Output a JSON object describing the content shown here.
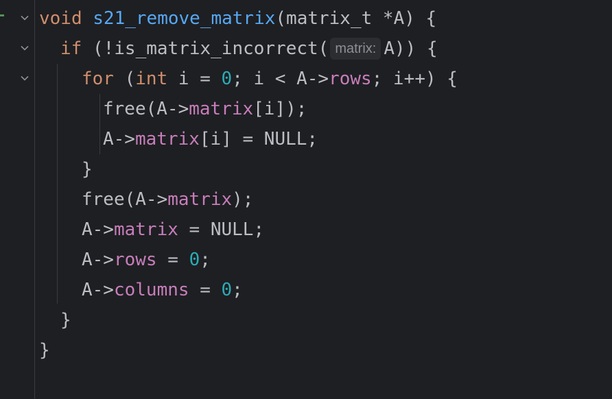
{
  "editor": {
    "lines": [
      {
        "tokens": [
          {
            "t": "kw",
            "v": "void"
          },
          {
            "t": "plain",
            "v": " "
          },
          {
            "t": "fn",
            "v": "s21_remove_matrix"
          },
          {
            "t": "plain",
            "v": "(matrix_t *A) {"
          }
        ]
      },
      {
        "tokens": [
          {
            "t": "kw",
            "v": "if"
          },
          {
            "t": "plain",
            "v": " (!is_matrix_incorrect("
          },
          {
            "t": "hint",
            "v": "matrix:"
          },
          {
            "t": "plain",
            "v": "A)) {"
          }
        ]
      },
      {
        "tokens": [
          {
            "t": "kw",
            "v": "for"
          },
          {
            "t": "plain",
            "v": " ("
          },
          {
            "t": "kw",
            "v": "int"
          },
          {
            "t": "plain",
            "v": " i = "
          },
          {
            "t": "num",
            "v": "0"
          },
          {
            "t": "plain",
            "v": "; i < A->"
          },
          {
            "t": "field",
            "v": "rows"
          },
          {
            "t": "plain",
            "v": "; i++) {"
          }
        ]
      },
      {
        "tokens": [
          {
            "t": "plain",
            "v": "free(A->"
          },
          {
            "t": "field",
            "v": "matrix"
          },
          {
            "t": "plain",
            "v": "[i]);"
          }
        ]
      },
      {
        "tokens": [
          {
            "t": "plain",
            "v": "A->"
          },
          {
            "t": "field",
            "v": "matrix"
          },
          {
            "t": "plain",
            "v": "[i] = NULL;"
          }
        ]
      },
      {
        "tokens": [
          {
            "t": "plain",
            "v": "}"
          }
        ]
      },
      {
        "tokens": [
          {
            "t": "plain",
            "v": "free(A->"
          },
          {
            "t": "field",
            "v": "matrix"
          },
          {
            "t": "plain",
            "v": ");"
          }
        ]
      },
      {
        "tokens": [
          {
            "t": "plain",
            "v": "A->"
          },
          {
            "t": "field",
            "v": "matrix"
          },
          {
            "t": "plain",
            "v": " = NULL;"
          }
        ]
      },
      {
        "tokens": [
          {
            "t": "plain",
            "v": "A->"
          },
          {
            "t": "field",
            "v": "rows"
          },
          {
            "t": "plain",
            "v": " = "
          },
          {
            "t": "num",
            "v": "0"
          },
          {
            "t": "plain",
            "v": ";"
          }
        ]
      },
      {
        "tokens": [
          {
            "t": "plain",
            "v": "A->"
          },
          {
            "t": "field",
            "v": "columns"
          },
          {
            "t": "plain",
            "v": " = "
          },
          {
            "t": "num",
            "v": "0"
          },
          {
            "t": "plain",
            "v": ";"
          }
        ]
      },
      {
        "tokens": [
          {
            "t": "plain",
            "v": "}"
          }
        ]
      },
      {
        "tokens": [
          {
            "t": "plain",
            "v": "}"
          }
        ]
      }
    ]
  },
  "gutter": {
    "fold_icon": "chevron-down-icon",
    "change_marker_color": "#549159"
  },
  "colors": {
    "background": "#1e1f22",
    "keyword": "#cf8e6d",
    "function": "#56a8f5",
    "field": "#c77dbb",
    "number": "#2aacb8",
    "text": "#bcbec4",
    "hint_text": "#8c8f96",
    "hint_bg": "#2b2d30"
  }
}
